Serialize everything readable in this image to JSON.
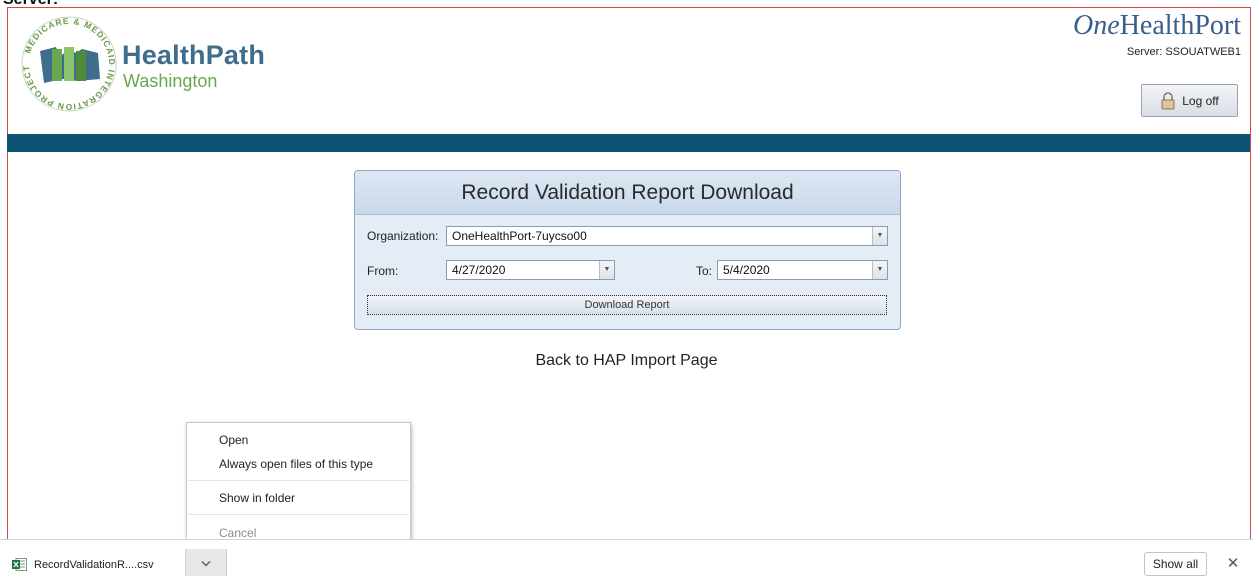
{
  "top_heading": "Server:",
  "header": {
    "logo_ring_text": "MEDICARE & MEDICAID INTEGRATION PROJECT",
    "brand_name": "HealthPath",
    "brand_sub": "Washington",
    "partner_logo_italic": "One",
    "partner_logo_rest": "HealthPort",
    "server_label": "Server: SSOUATWEB1",
    "logoff_label": "Log off"
  },
  "report_form": {
    "title": "Record Validation Report Download",
    "organization_label": "Organization:",
    "organization_value": "OneHealthPort-7uycso00",
    "from_label": "From:",
    "from_value": "4/27/2020",
    "to_label": "To:",
    "to_value": "5/4/2020",
    "download_button": "Download Report"
  },
  "back_link": "Back to HAP Import Page",
  "context_menu": {
    "open": "Open",
    "always_open": "Always open files of this type",
    "show_in_folder": "Show in folder",
    "cancel": "Cancel"
  },
  "download_bar": {
    "file_name": "RecordValidationR....csv",
    "show_all": "Show all",
    "close": "✕"
  },
  "colors": {
    "header_bar": "#0d5473",
    "brand_blue": "#3f6e8c",
    "brand_green": "#6aa84f",
    "panel_bg": "#e4ecf6"
  }
}
